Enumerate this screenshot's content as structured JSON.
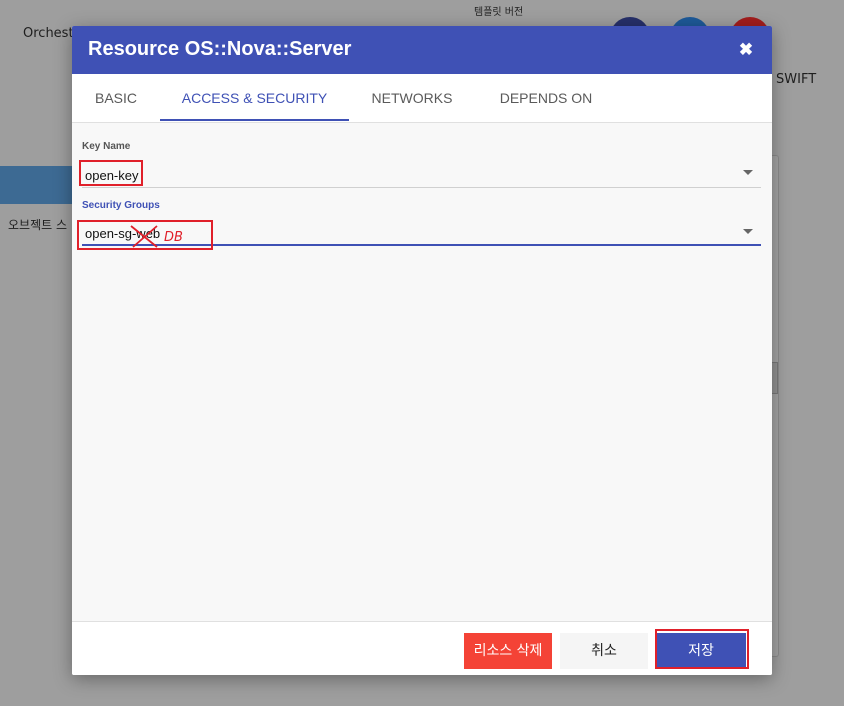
{
  "background": {
    "nav_label": "Orchestr",
    "template_version_label": "템플릿 버전",
    "right_label": "SWIFT",
    "left_menu_label": "오브젝트 스"
  },
  "dialog": {
    "title": "Resource OS::Nova::Server",
    "close_icon": "close-icon",
    "tabs": [
      {
        "label": "BASIC"
      },
      {
        "label": "ACCESS & SECURITY",
        "active": true
      },
      {
        "label": "NETWORKS"
      },
      {
        "label": "DEPENDS ON"
      }
    ],
    "fields": {
      "key_name": {
        "label": "Key Name",
        "value": "open-key"
      },
      "security_groups": {
        "label": "Security Groups",
        "value": "open-sg-web"
      }
    },
    "annotation_text": "DB",
    "footer": {
      "delete_label": "리소스 삭제",
      "cancel_label": "취소",
      "save_label": "저장"
    }
  },
  "colors": {
    "primary": "#3f51b5",
    "danger": "#f44336",
    "highlight": "#e0202a"
  }
}
